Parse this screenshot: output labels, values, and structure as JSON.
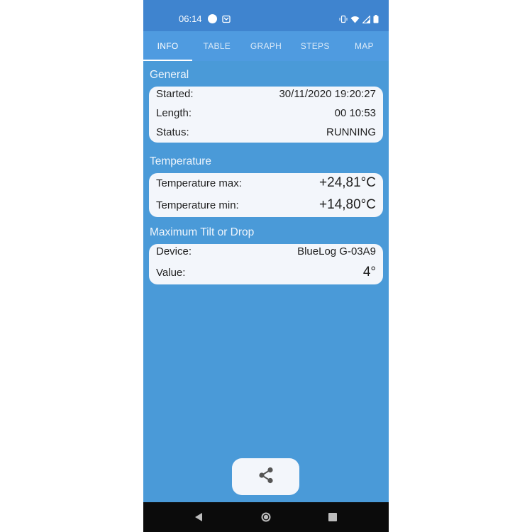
{
  "status_bar": {
    "time": "06:14",
    "icons": [
      "record-dot-icon",
      "notification-icon",
      "vibrate-icon",
      "wifi-icon",
      "signal-icon",
      "battery-icon"
    ]
  },
  "tabs": [
    {
      "label": "INFO",
      "active": true
    },
    {
      "label": "TABLE",
      "active": false
    },
    {
      "label": "GRAPH",
      "active": false
    },
    {
      "label": "STEPS",
      "active": false
    },
    {
      "label": "MAP",
      "active": false
    }
  ],
  "general": {
    "title": "General",
    "rows": [
      {
        "key": "Started:",
        "value": "30/11/2020 19:20:27"
      },
      {
        "key": "Length:",
        "value": "00 10:53"
      },
      {
        "key": "Status:",
        "value": "RUNNING"
      }
    ]
  },
  "temperature": {
    "title": "Temperature",
    "rows": [
      {
        "key": "Temperature max:",
        "value": "+24,81°C"
      },
      {
        "key": "Temperature min:",
        "value": "+14,80°C"
      }
    ]
  },
  "tilt": {
    "title": "Maximum Tilt or Drop",
    "rows": [
      {
        "key": "Device:",
        "value": "BlueLog G-03A9"
      },
      {
        "key": "Value:",
        "value": "4°"
      }
    ]
  },
  "share_button": {
    "icon": "share-icon"
  },
  "nav_bar": {
    "icons": [
      "back-icon",
      "home-icon",
      "recents-icon"
    ]
  },
  "colors": {
    "status_bar": "#3f84cf",
    "tab_bar": "#4f9be0",
    "background": "#4a9ad8",
    "card": "#f3f6fb",
    "nav_bar": "#0b0b0b"
  }
}
